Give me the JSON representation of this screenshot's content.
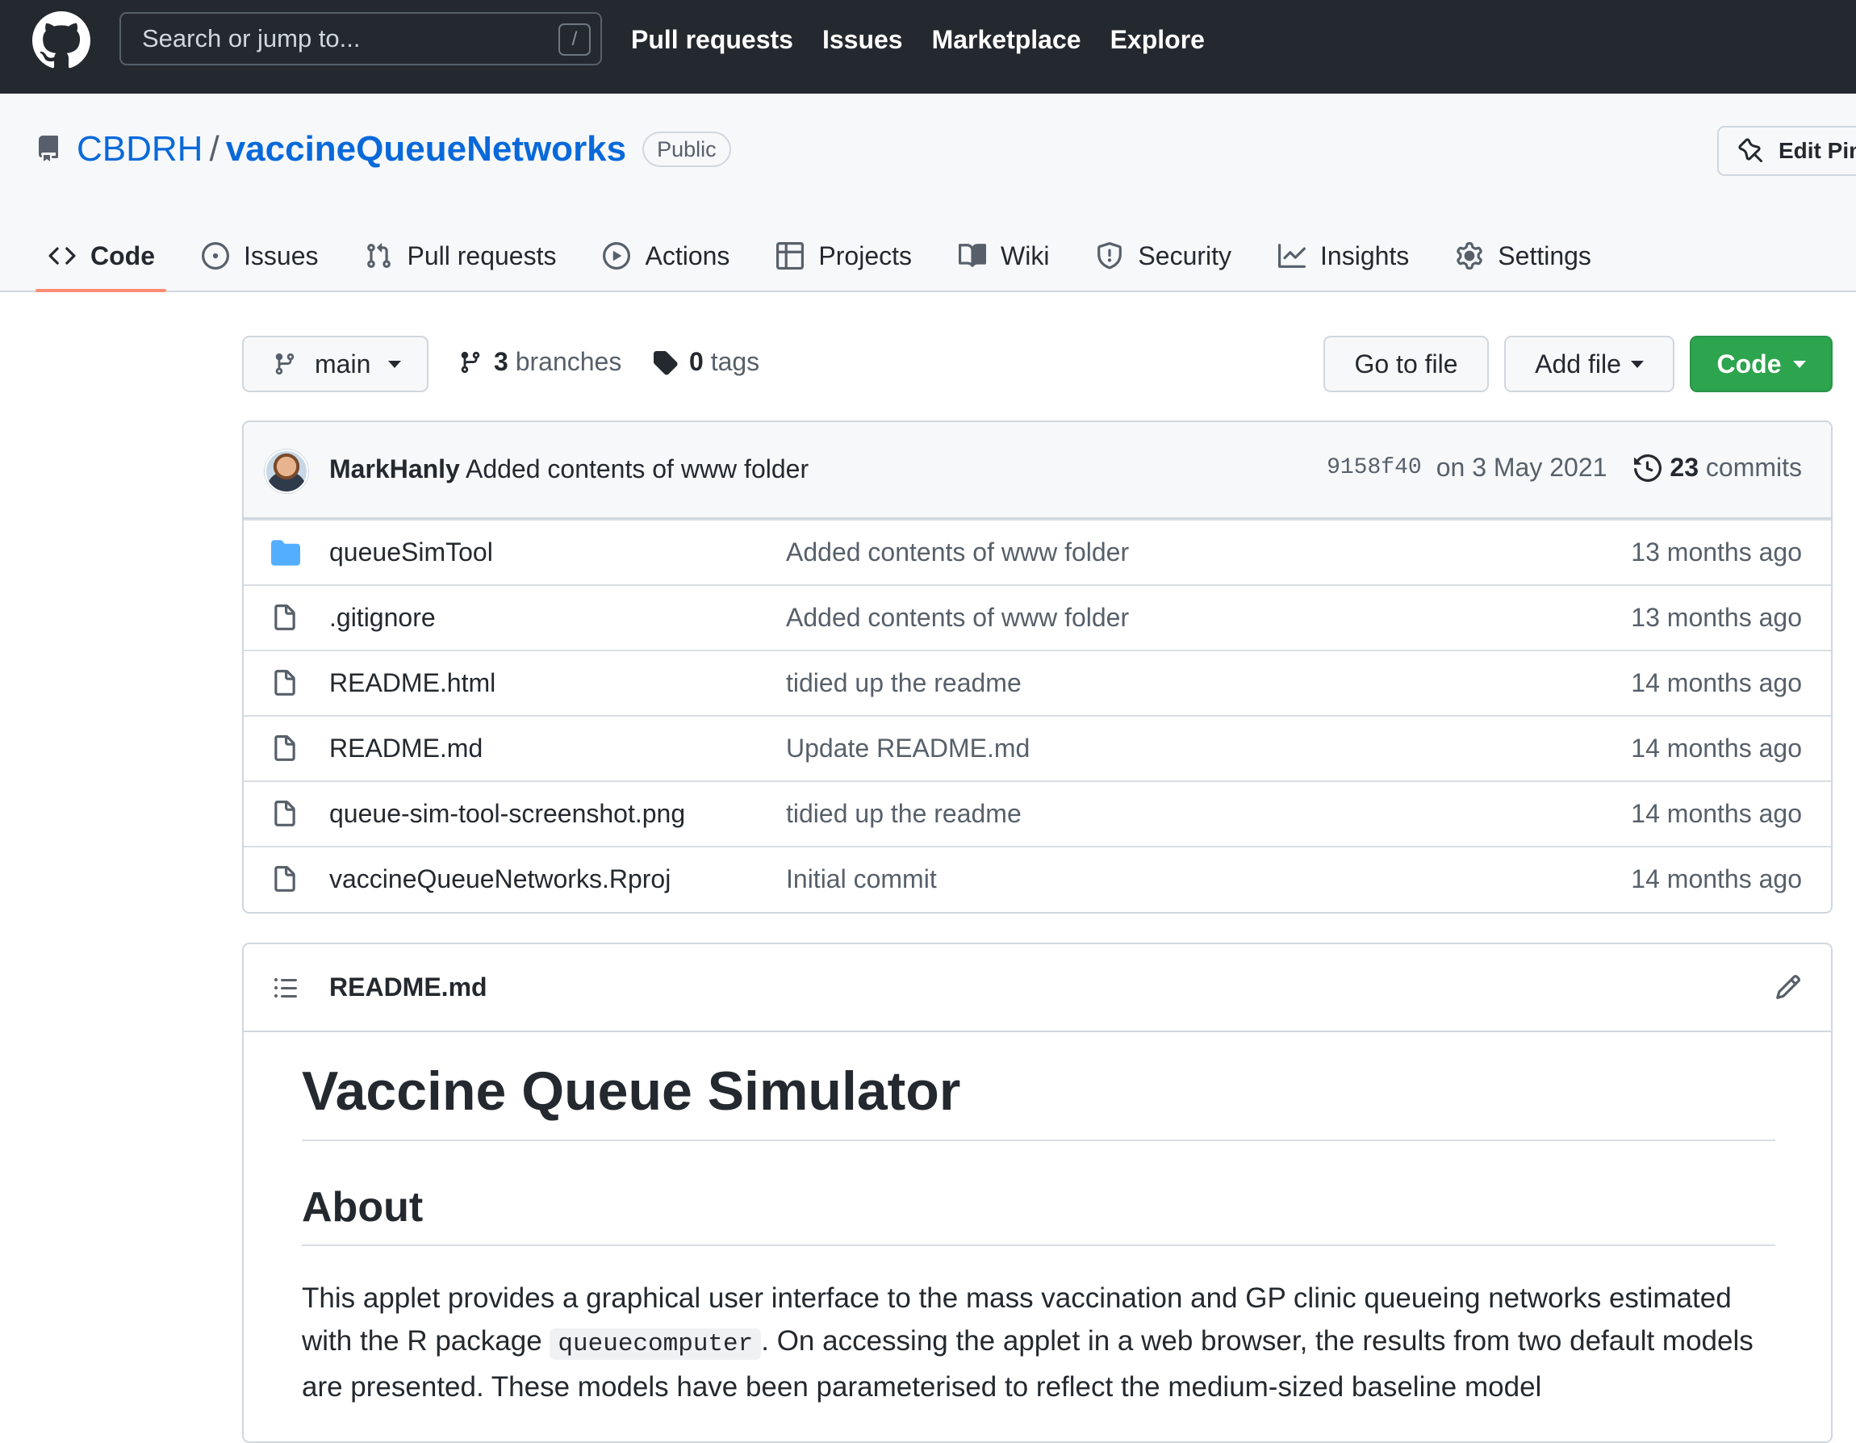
{
  "header": {
    "search_placeholder": "Search or jump to...",
    "search_shortcut": "/",
    "nav": [
      "Pull requests",
      "Issues",
      "Marketplace",
      "Explore"
    ]
  },
  "repo": {
    "owner": "CBDRH",
    "separator": "/",
    "name": "vaccineQueueNetworks",
    "visibility": "Public",
    "pin_label": "Edit Pins"
  },
  "tabs": [
    {
      "label": "Code",
      "icon": "code-icon",
      "active": true
    },
    {
      "label": "Issues",
      "icon": "issue-icon"
    },
    {
      "label": "Pull requests",
      "icon": "pull-request-icon"
    },
    {
      "label": "Actions",
      "icon": "play-icon"
    },
    {
      "label": "Projects",
      "icon": "table-icon"
    },
    {
      "label": "Wiki",
      "icon": "book-icon"
    },
    {
      "label": "Security",
      "icon": "shield-icon"
    },
    {
      "label": "Insights",
      "icon": "graph-icon"
    },
    {
      "label": "Settings",
      "icon": "gear-icon"
    }
  ],
  "filenav": {
    "branch": "main",
    "branches_count": "3",
    "branches_label": "branches",
    "tags_count": "0",
    "tags_label": "tags",
    "goto_label": "Go to file",
    "addfile_label": "Add file",
    "code_label": "Code"
  },
  "latest_commit": {
    "author": "MarkHanly",
    "message": "Added contents of www folder",
    "sha": "9158f40",
    "date": "on 3 May 2021",
    "commits_count": "23",
    "commits_label": "commits"
  },
  "files": [
    {
      "name": "queueSimTool",
      "type": "folder",
      "message": "Added contents of www folder",
      "age": "13 months ago"
    },
    {
      "name": ".gitignore",
      "type": "file",
      "message": "Added contents of www folder",
      "age": "13 months ago"
    },
    {
      "name": "README.html",
      "type": "file",
      "message": "tidied up the readme",
      "age": "14 months ago"
    },
    {
      "name": "README.md",
      "type": "file",
      "message": "Update README.md",
      "age": "14 months ago"
    },
    {
      "name": "queue-sim-tool-screenshot.png",
      "type": "file",
      "message": "tidied up the readme",
      "age": "14 months ago"
    },
    {
      "name": "vaccineQueueNetworks.Rproj",
      "type": "file",
      "message": "Initial commit",
      "age": "14 months ago"
    }
  ],
  "readme": {
    "filename": "README.md",
    "h1": "Vaccine Queue Simulator",
    "h2": "About",
    "para_part1": "This applet provides a graphical user interface to the mass vaccination and GP clinic queueing networks estimated with the R package ",
    "para_code": "queuecomputer",
    "para_part2": ". On accessing the applet in a web browser, the results from two default models are presented. These models have been parameterised to reflect the medium-sized baseline model"
  },
  "colors": {
    "header_bg": "#24292f",
    "link": "#0969da",
    "active_tab_underline": "#fd8c73",
    "code_button": "#2da44e",
    "folder": "#54aeff"
  }
}
